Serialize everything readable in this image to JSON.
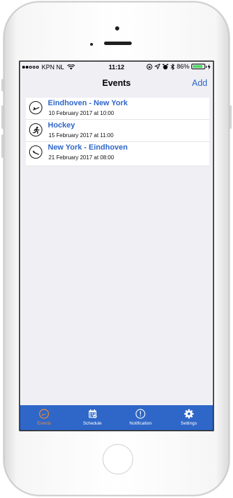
{
  "status_bar": {
    "carrier": "KPN NL",
    "time": "11:12",
    "battery": "86%",
    "battery_level": 0.86,
    "signal_full": 2,
    "signal_empty": 3
  },
  "nav": {
    "title": "Events",
    "add_label": "Add"
  },
  "events": [
    {
      "title": "Eindhoven - New York",
      "subtitle": "10 February 2017 at 10:00",
      "icon": "plane-takeoff-icon"
    },
    {
      "title": "Hockey",
      "subtitle": "15 February 2017 at 11:00",
      "icon": "running-person-icon"
    },
    {
      "title": "New York - Eindhoven",
      "subtitle": "21 February 2017 at 08:00",
      "icon": "plane-landing-icon"
    }
  ],
  "tabs": [
    {
      "label": "Events",
      "icon": "plane-icon",
      "active": true
    },
    {
      "label": "Schedule",
      "icon": "calendar-icon",
      "active": false
    },
    {
      "label": "Notification",
      "icon": "alert-icon",
      "active": false
    },
    {
      "label": "Settings",
      "icon": "gear-icon",
      "active": false
    }
  ],
  "colors": {
    "accent": "#2f67c8",
    "active_tab": "#f28a30",
    "battery": "#4cd964"
  }
}
